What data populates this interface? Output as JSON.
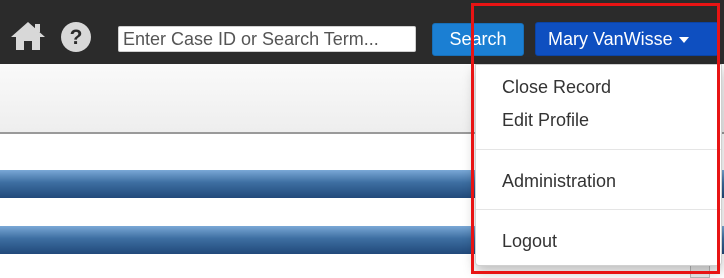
{
  "navbar": {
    "home_icon": "home-icon",
    "help_icon": "question-circle-icon",
    "search": {
      "placeholder": "Enter Case ID or Search Term...",
      "value": ""
    },
    "search_button": "Search",
    "user_menu": {
      "label": "Mary VanWisse",
      "caret_icon": "caret-down-icon"
    }
  },
  "dropdown": {
    "items": [
      "Close Record",
      "Edit Profile",
      "Administration",
      "Logout"
    ]
  },
  "colors": {
    "navbar_bg": "#2b2b2b",
    "search_button": "#1b7fd3",
    "user_button": "#0e4fc0",
    "highlight_border": "#e81414"
  }
}
